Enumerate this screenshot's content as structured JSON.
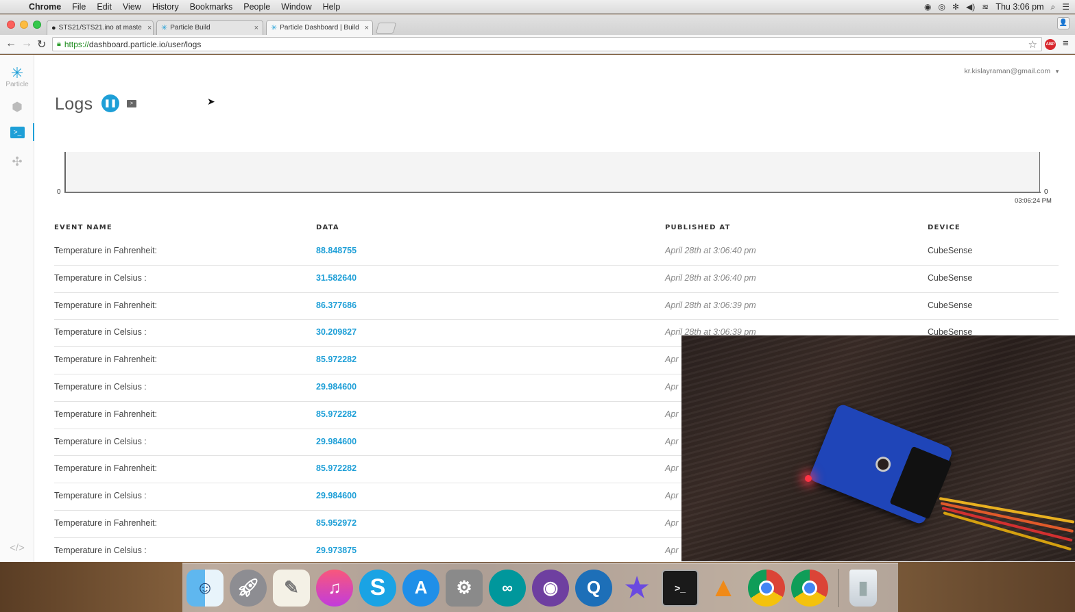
{
  "menubar": {
    "app": "Chrome",
    "items": [
      "File",
      "Edit",
      "View",
      "History",
      "Bookmarks",
      "People",
      "Window",
      "Help"
    ],
    "clock": "Thu 3:06 pm"
  },
  "tabs": [
    {
      "title": "STS21/STS21.ino at maste",
      "icon": "github-icon"
    },
    {
      "title": "Particle Build",
      "icon": "particle-icon"
    },
    {
      "title": "Particle Dashboard | Build",
      "icon": "particle-icon",
      "active": true
    }
  ],
  "address": {
    "scheme": "https://",
    "rest": "dashboard.particle.io/user/logs"
  },
  "sidebar": {
    "logo_label": "Particle"
  },
  "header": {
    "user_email": "kr.kislayraman@gmail.com",
    "title": "Logs"
  },
  "chart": {
    "y_left_tick": "0",
    "y_right_tick": "0",
    "x_tick": "03:06:24 PM"
  },
  "table": {
    "columns": [
      "EVENT NAME",
      "DATA",
      "PUBLISHED AT",
      "DEVICE"
    ],
    "rows": [
      {
        "name": "Temperature in Fahrenheit:",
        "data": "88.848755",
        "published": "April 28th at 3:06:40 pm",
        "device": "CubeSense"
      },
      {
        "name": "Temperature in Celsius :",
        "data": "31.582640",
        "published": "April 28th at 3:06:40 pm",
        "device": "CubeSense"
      },
      {
        "name": "Temperature in Fahrenheit:",
        "data": "86.377686",
        "published": "April 28th at 3:06:39 pm",
        "device": "CubeSense"
      },
      {
        "name": "Temperature in Celsius :",
        "data": "30.209827",
        "published": "April 28th at 3:06:39 pm",
        "device": "CubeSense"
      },
      {
        "name": "Temperature in Fahrenheit:",
        "data": "85.972282",
        "published": "Apr",
        "device": ""
      },
      {
        "name": "Temperature in Celsius :",
        "data": "29.984600",
        "published": "Apr",
        "device": ""
      },
      {
        "name": "Temperature in Fahrenheit:",
        "data": "85.972282",
        "published": "Apr",
        "device": ""
      },
      {
        "name": "Temperature in Celsius :",
        "data": "29.984600",
        "published": "Apr",
        "device": ""
      },
      {
        "name": "Temperature in Fahrenheit:",
        "data": "85.972282",
        "published": "Apr",
        "device": ""
      },
      {
        "name": "Temperature in Celsius :",
        "data": "29.984600",
        "published": "Apr",
        "device": ""
      },
      {
        "name": "Temperature in Fahrenheit:",
        "data": "85.952972",
        "published": "Apr",
        "device": ""
      },
      {
        "name": "Temperature in Celsius :",
        "data": "29.973875",
        "published": "Apr",
        "device": ""
      }
    ]
  },
  "dock": [
    "finder-icon",
    "launchpad-icon",
    "textedit-icon",
    "itunes-icon",
    "skype-icon",
    "appstore-icon",
    "system-preferences-icon",
    "arduino-icon",
    "github-desktop-icon",
    "quicktime-icon",
    "imovie-icon",
    "terminal-icon",
    "vlc-icon",
    "chrome-icon",
    "chrome-icon",
    "trash-icon"
  ],
  "colors": {
    "accent": "#1e9fd7",
    "data_text": "#1e9fd7"
  }
}
